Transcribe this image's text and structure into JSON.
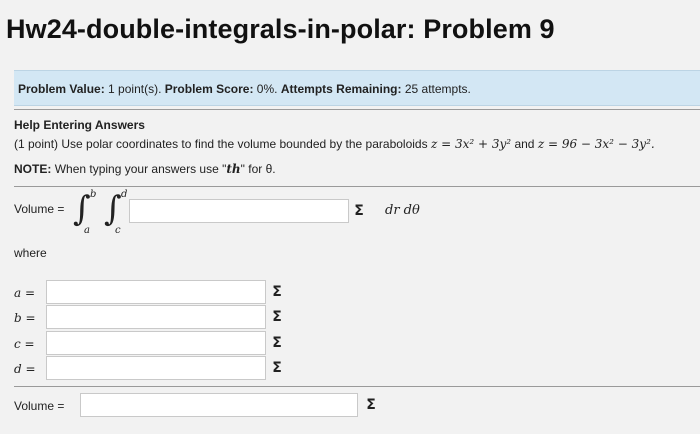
{
  "title": "Hw24-double-integrals-in-polar: Problem 9",
  "info": {
    "value_label": "Problem Value:",
    "value": "1 point(s).",
    "score_label": "Problem Score:",
    "score": "0%.",
    "attempts_label": "Attempts Remaining:",
    "attempts": "25 attempts."
  },
  "help": {
    "heading": "Help Entering Answers",
    "problem_prefix": "(1 point) Use polar coordinates to find the volume bounded by the paraboloids",
    "eq1": "z = 3x² + 3y²",
    "and": "and",
    "eq2": "z = 96 − 3x² − 3y².",
    "note_label": "NOTE:",
    "note_text": "When typing your answers use \"th\" for θ.",
    "note_start": "When typing your answers use \"",
    "note_th": "th",
    "note_end": "\" for θ."
  },
  "integral": {
    "volume_label": "Volume =",
    "upper_outer": "b",
    "lower_outer": "a",
    "upper_inner": "d",
    "lower_inner": "c",
    "differential": "dr dθ"
  },
  "where_label": "where",
  "vars": [
    {
      "name": "a =",
      "value": ""
    },
    {
      "name": "b =",
      "value": ""
    },
    {
      "name": "c =",
      "value": ""
    },
    {
      "name": "d =",
      "value": ""
    }
  ],
  "final": {
    "volume_label": "Volume =",
    "value": ""
  },
  "sigma_icon": "Σ"
}
